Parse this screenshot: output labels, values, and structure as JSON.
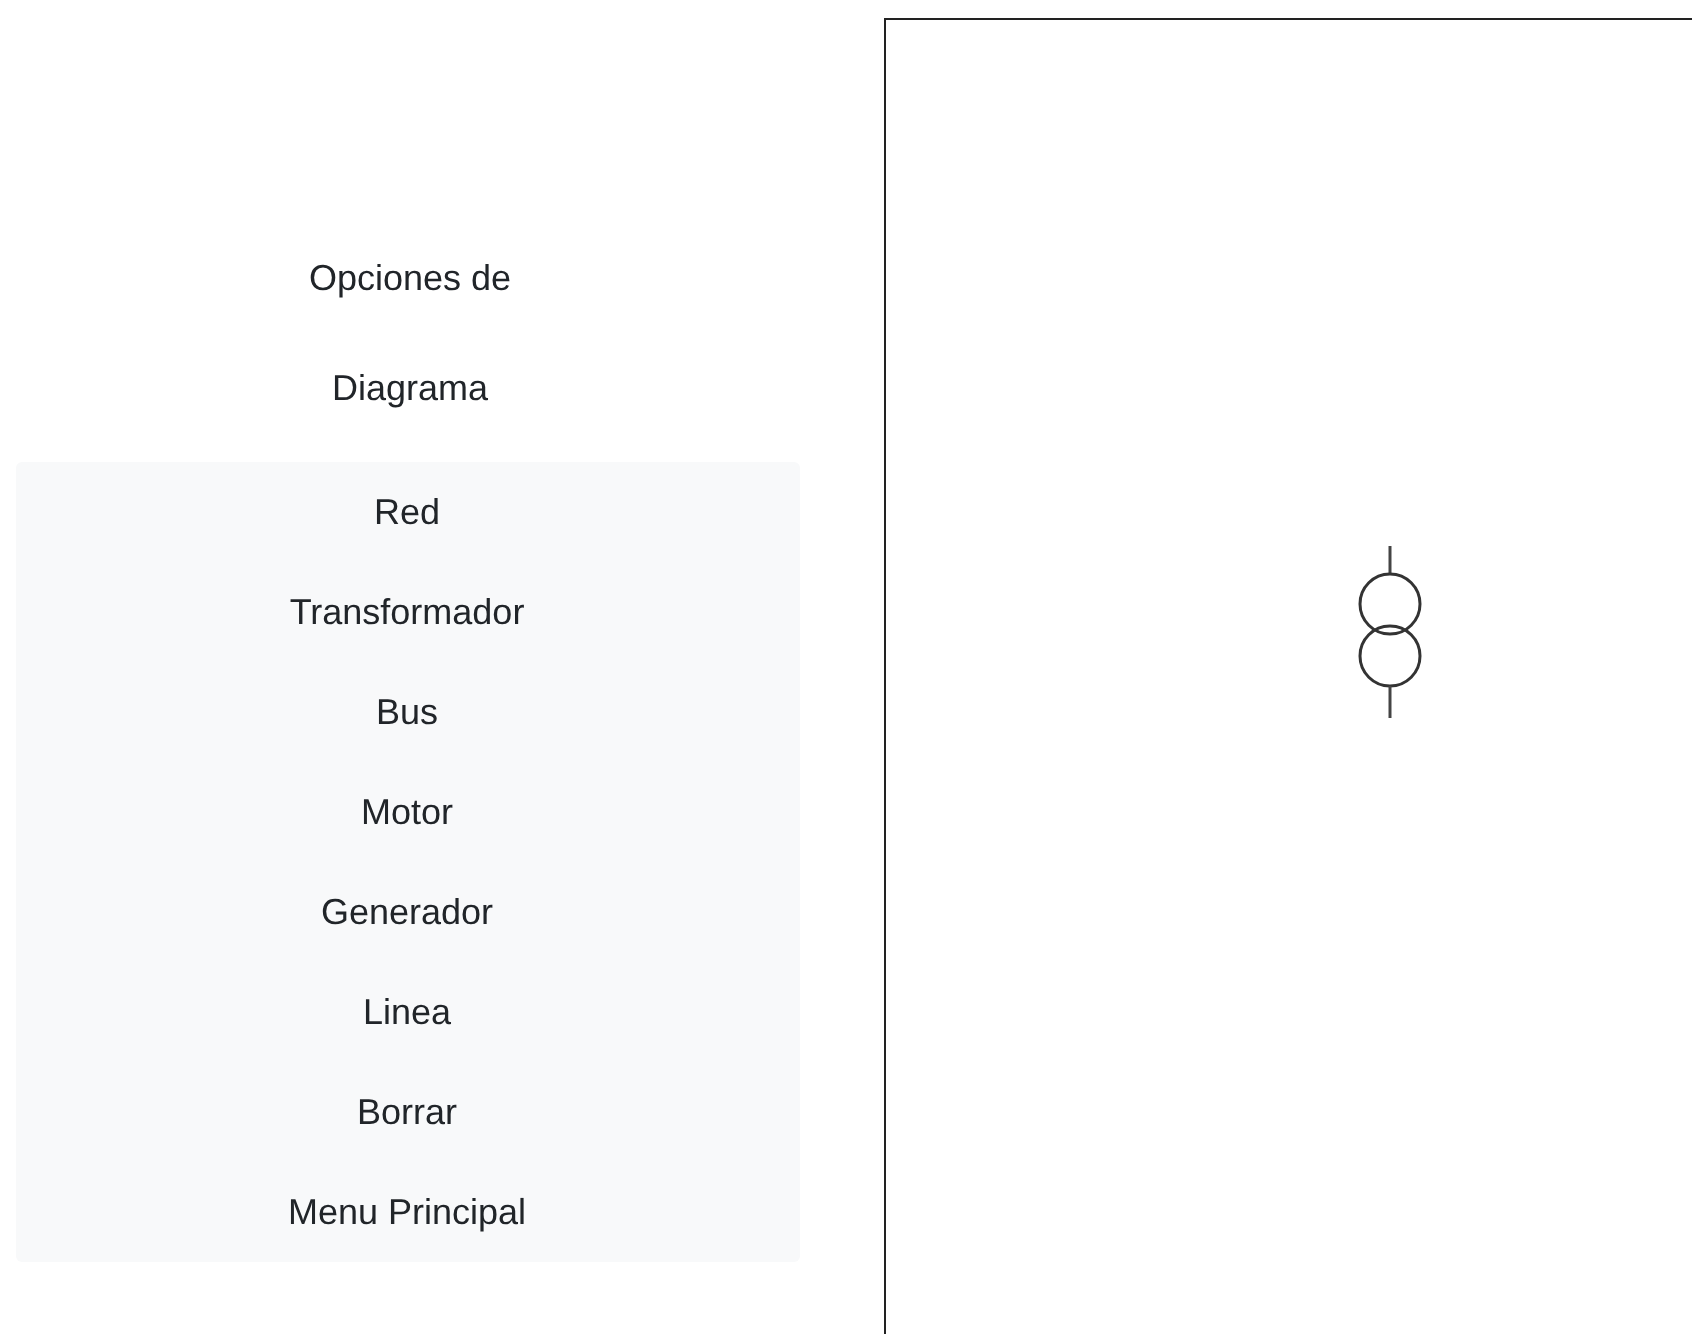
{
  "sidebar": {
    "title": "Opciones de Diagrama",
    "items": [
      {
        "label": "Red"
      },
      {
        "label": "Transformador"
      },
      {
        "label": "Bus"
      },
      {
        "label": "Motor"
      },
      {
        "label": "Generador"
      },
      {
        "label": "Linea"
      },
      {
        "label": "Borrar"
      },
      {
        "label": "Menu Principal"
      }
    ]
  },
  "canvas": {
    "elements": [
      {
        "kind": "transformer"
      }
    ]
  }
}
